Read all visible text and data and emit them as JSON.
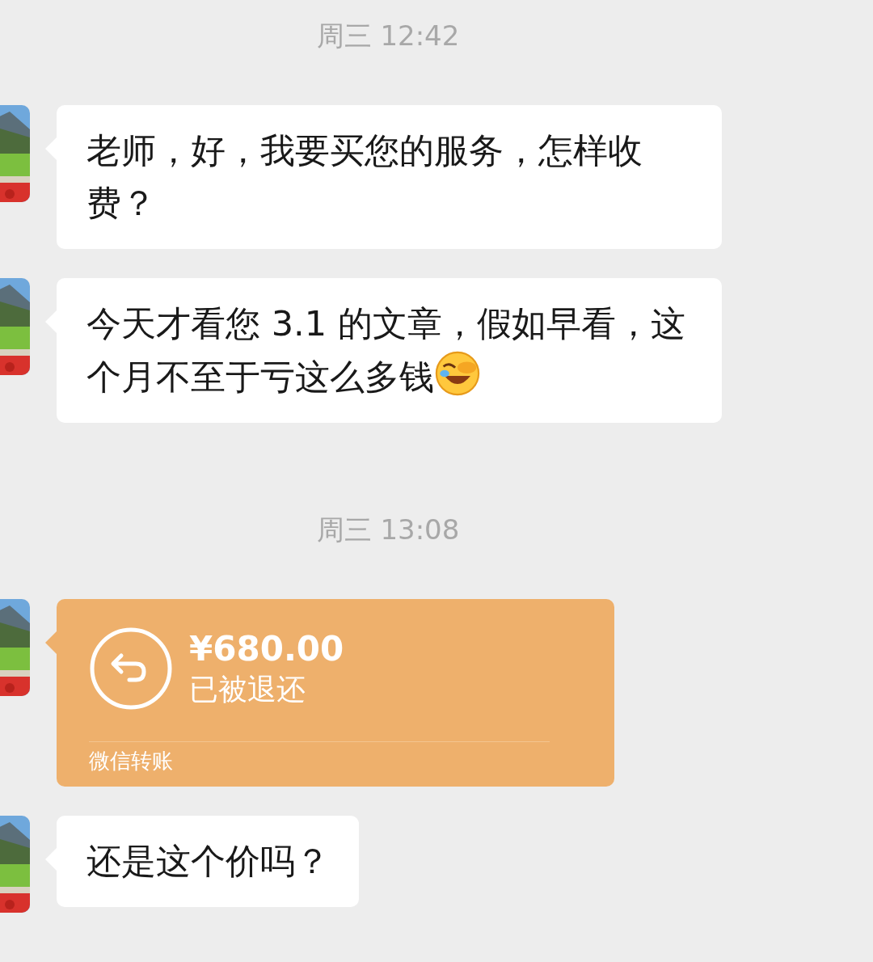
{
  "messages": [
    {
      "kind": "time",
      "text": "周三 12:42"
    },
    {
      "kind": "text",
      "text": "老师，好，我要买您的服务，怎样收费？",
      "emoji": false
    },
    {
      "kind": "text",
      "text": "今天才看您 3.1 的文章，假如早看，这个月不至于亏这么多钱",
      "emoji": true
    },
    {
      "kind": "time",
      "text": "周三 13:08"
    },
    {
      "kind": "transfer",
      "amount": "¥680.00",
      "status": "已被退还",
      "footer": "微信转账"
    },
    {
      "kind": "text",
      "text": "还是这个价吗？",
      "emoji": false
    }
  ]
}
